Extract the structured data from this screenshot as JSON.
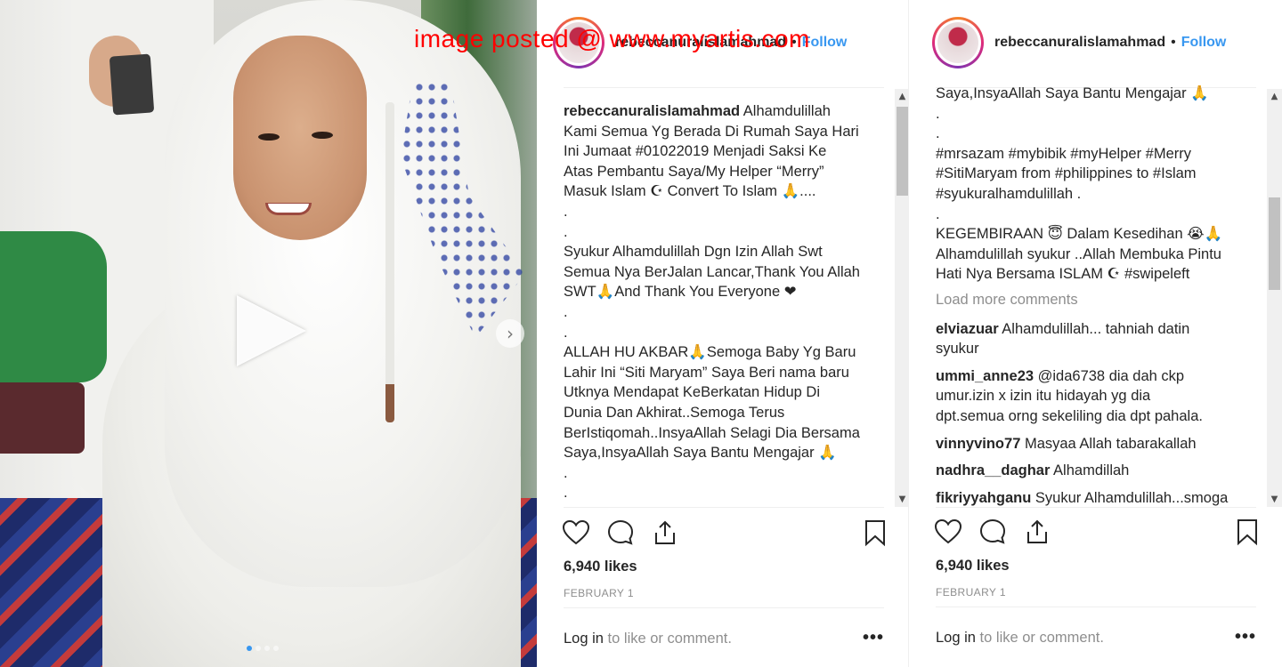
{
  "watermark": "image posted @ www.myartis.com",
  "media": {
    "dot_count": 4,
    "active_dot": 0,
    "next_symbol": "›"
  },
  "post_left": {
    "username": "rebeccanuralislamahmad",
    "separator": "•",
    "follow_label": "Follow",
    "caption_lines": [
      {
        "user": "rebeccanuralislamahmad",
        "text": " Alhamdulillah"
      },
      {
        "text": "Kami Semua Yg Berada Di Rumah Saya Hari"
      },
      {
        "text": "Ini Jumaat #01022019 Menjadi Saksi Ke"
      },
      {
        "text": "Atas Pembantu Saya/My Helper “Merry”"
      },
      {
        "text": "Masuk Islam ☪ Convert To Islam 🙏....",
        "emoji": "purple"
      },
      {
        "text": "."
      },
      {
        "text": "."
      },
      {
        "text": "Syukur Alhamdulillah Dgn Izin Allah Swt"
      },
      {
        "text": "Semua Nya BerJalan Lancar,Thank You Allah"
      },
      {
        "text": "SWT🙏And Thank You Everyone ❤",
        "emoji": "red"
      },
      {
        "text": "."
      },
      {
        "text": "."
      },
      {
        "text": "ALLAH HU AKBAR🙏Semoga Baby Yg Baru"
      },
      {
        "text": "Lahir Ini “Siti Maryam” Saya Beri nama baru"
      },
      {
        "text": "Utknya Mendapat KeBerkatan Hidup Di"
      },
      {
        "text": "Dunia Dan Akhirat..Semoga Terus"
      },
      {
        "text": "BerIstiqomah..InsyaAllah Selagi Dia Bersama"
      },
      {
        "text": "Saya,InsyaAllah Saya Bantu Mengajar 🙏"
      },
      {
        "text": "."
      },
      {
        "text": "."
      }
    ],
    "likes": "6,940 likes",
    "date": "FEBRUARY 1",
    "login_link": "Log in",
    "login_rest": " to like or comment.",
    "more": "•••"
  },
  "post_right": {
    "username": "rebeccanuralislamahmad",
    "separator": "•",
    "follow_label": "Follow",
    "caption_lines": [
      {
        "text": "Saya,InsyaAllah Saya Bantu Mengajar 🙏"
      },
      {
        "text": "."
      },
      {
        "text": "."
      },
      {
        "text": "#mrsazam #mybibik #myHelper #Merry"
      },
      {
        "text": "#SitiMaryam from #philippines to #Islam"
      },
      {
        "text": "#syukuralhamdulillah ."
      },
      {
        "text": "."
      },
      {
        "text": "KEGEMBIRAAN 😇 Dalam Kesedihan 😭🙏"
      },
      {
        "text": "Alhamdulillah syukur ..Allah Membuka Pintu"
      },
      {
        "text": "Hati Nya Bersama ISLAM ☪ #swipeleft"
      }
    ],
    "load_more": "Load more comments",
    "replies": [
      {
        "user": "elviazuar",
        "lines": [
          " Alhamdulillah... tahniah datin",
          "syukur"
        ]
      },
      {
        "user": "ummi_anne23",
        "lines": [
          " @ida6738 dia dah ckp",
          "umur.izin x izin itu hidayah yg dia",
          "dpt.semua orng sekeliling dia dpt pahala."
        ]
      },
      {
        "user": "vinnyvino77",
        "lines": [
          " Masyaa Allah tabarakallah"
        ]
      },
      {
        "user": "nadhra__daghar",
        "lines": [
          " Alhamdillah"
        ]
      },
      {
        "user": "fikriyyahganu",
        "lines": [
          " Syukur Alhamdulillah...smoga"
        ]
      }
    ],
    "likes": "6,940 likes",
    "date": "FEBRUARY 1",
    "login_link": "Log in",
    "login_rest": " to like or comment.",
    "more": "•••"
  },
  "icons": [
    "heart-icon",
    "comment-icon",
    "share-icon",
    "bookmark-icon",
    "play-icon",
    "chevron-right-icon"
  ],
  "colors": {
    "link_blue": "#3897f0",
    "text": "#262626",
    "muted": "#8e8e8e",
    "watermark": "#ff0000"
  }
}
